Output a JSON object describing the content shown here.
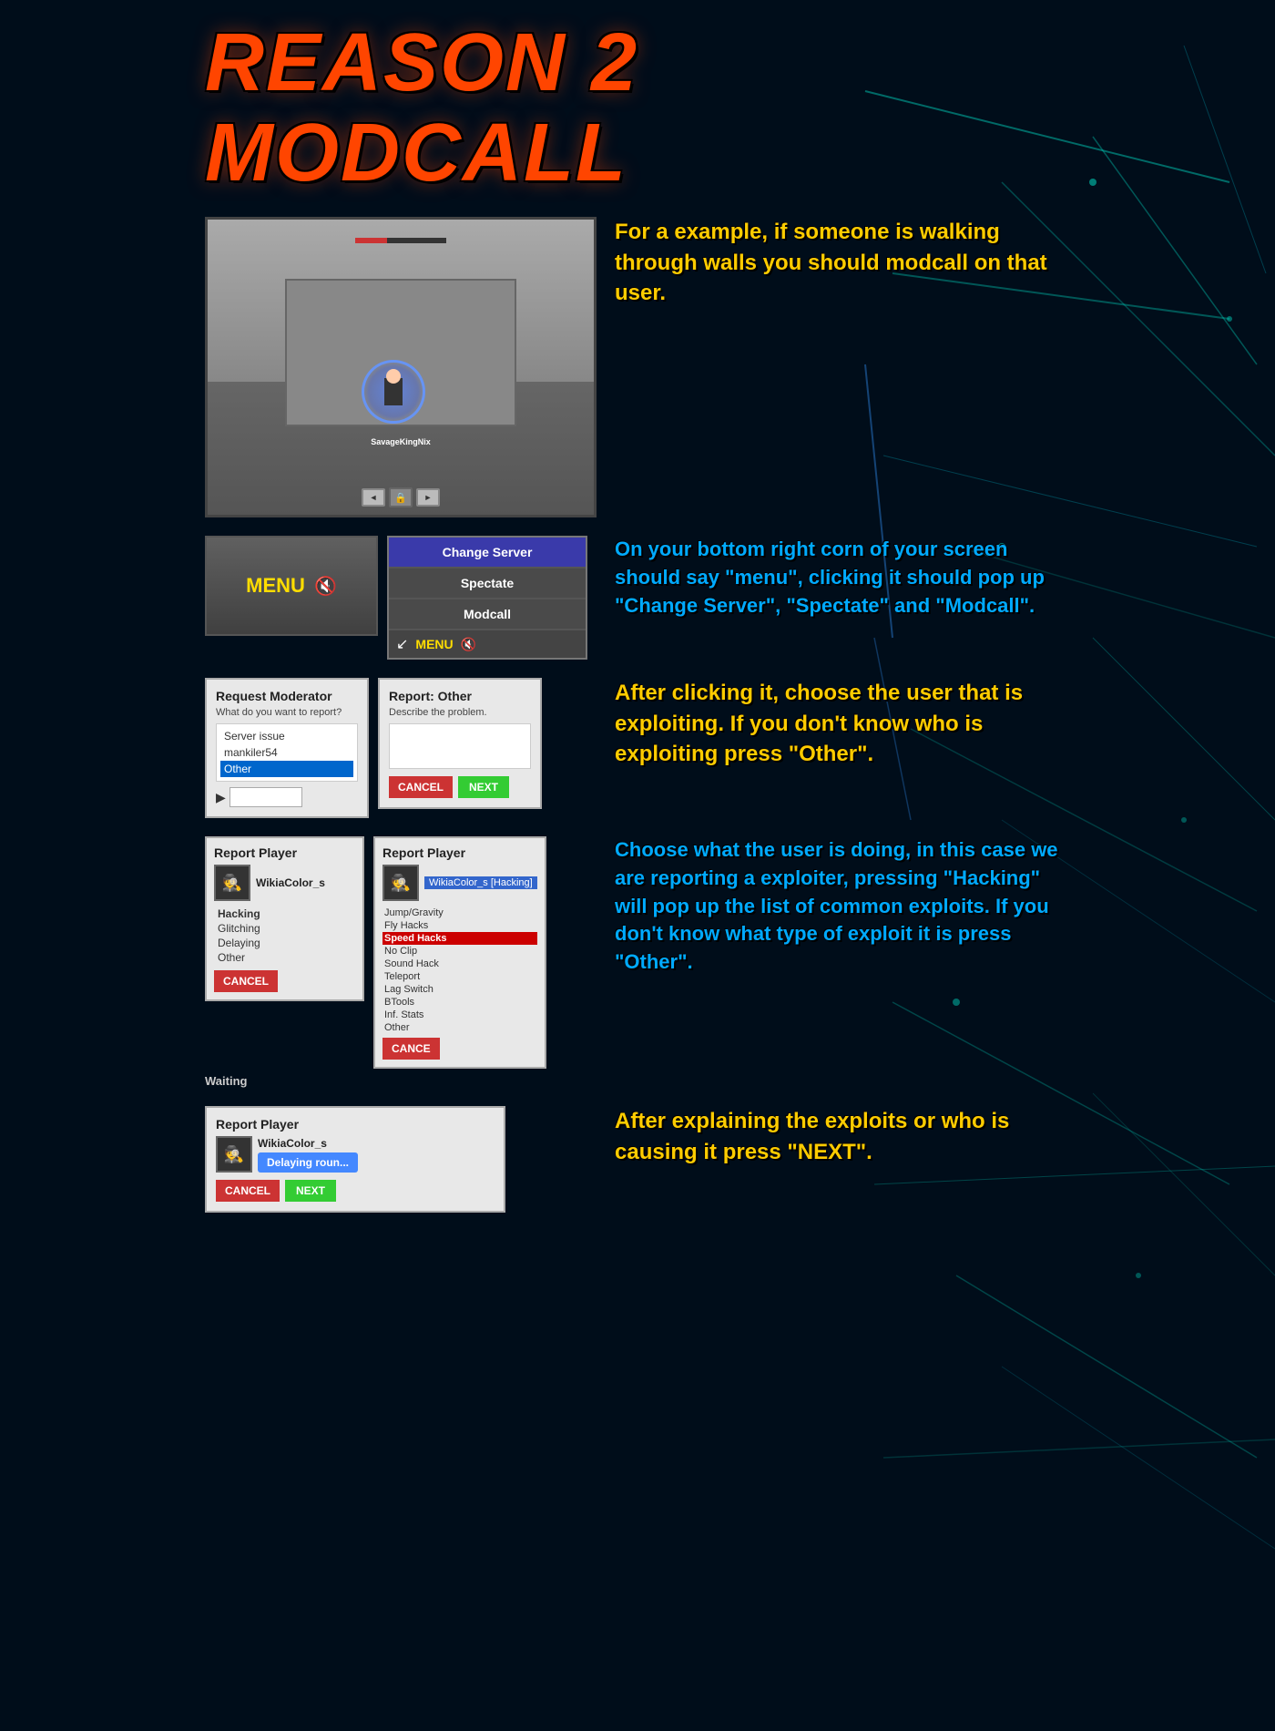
{
  "page": {
    "title": "REASON 2 MODCALL",
    "bg_color": "#000d1a"
  },
  "section1": {
    "game_area": {
      "health_bar_label": "health",
      "player_name": "SavageKingNix",
      "nav_left": "◄",
      "nav_lock": "🔒",
      "nav_right": "►"
    },
    "text": "For a example, if someone is walking through walls you should modcall on that user."
  },
  "section2": {
    "menu_label": "MENU",
    "popup_buttons": {
      "change_server": "Change Server",
      "spectate": "Spectate",
      "modcall": "Modcall"
    },
    "menu_bottom": "MENU",
    "text": "On your bottom right corn of your screen should say \"menu\", clicking it should pop up \"Change Server\", \"Spectate\" and \"Modcall\"."
  },
  "section3": {
    "request_moderator": {
      "title": "Request Moderator",
      "subtitle": "What do you want to report?",
      "options": [
        "Server issue",
        "mankiler54",
        "Other"
      ],
      "selected": "Other"
    },
    "report_other": {
      "title": "Report: Other",
      "describe": "Describe the problem.",
      "cancel": "CANCEL",
      "next": "NEXT"
    },
    "text": "After clicking it, choose the user that is exploiting. If you don't know who is exploiting press \"Other\"."
  },
  "section4": {
    "report_player_1": {
      "title": "Report Player",
      "player": "WikiaColor_s",
      "options": [
        "Hacking",
        "Glitching",
        "Delaying",
        "Other"
      ],
      "selected": "Hacking",
      "cancel": "CANCEL"
    },
    "report_player_2": {
      "title": "Report Player",
      "player": "WikiaColor_s [Hacking]",
      "hacking_options": [
        "Jump/Gravity",
        "Fly Hacks",
        "Speed Hacks",
        "No Clip",
        "Sound Hack",
        "Teleport",
        "Lag Switch",
        "BTools",
        "Inf. Stats",
        "Other"
      ],
      "selected": "Speed Hacks",
      "cancel": "CANCE"
    },
    "waiting_text": "Waiting",
    "text": "Choose what the user is doing, in this case we are reporting a exploiter, pressing \"Hacking\" will pop up the list of common exploits. If you don't know what type of exploit it is press \"Other\"."
  },
  "section5": {
    "report_player": {
      "title": "Report Player",
      "player": "WikiaColor_s",
      "status": "Delaying roun...",
      "cancel": "CANCEL",
      "next": "NEXT"
    },
    "text": "After explaining the exploits or who is causing it press \"NEXT\"."
  },
  "icons": {
    "speaker": "🔇",
    "left_arrow": "◄",
    "right_arrow": "►",
    "lock": "🔒",
    "hacker_avatar": "🕵️"
  }
}
